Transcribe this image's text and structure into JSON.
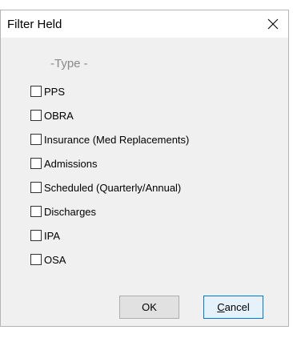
{
  "window": {
    "title": "Filter Held",
    "close_icon": "close-icon"
  },
  "type_group": {
    "label": "-Type -",
    "options": [
      {
        "label": "PPS",
        "checked": false
      },
      {
        "label": "OBRA",
        "checked": false
      },
      {
        "label": "Insurance (Med Replacements)",
        "checked": false
      },
      {
        "label": "Admissions",
        "checked": false
      },
      {
        "label": "Scheduled (Quarterly/Annual)",
        "checked": false
      },
      {
        "label": "Discharges",
        "checked": false
      },
      {
        "label": "IPA",
        "checked": false
      },
      {
        "label": "OSA",
        "checked": false
      }
    ]
  },
  "buttons": {
    "ok_label": "OK",
    "cancel_accel": "C",
    "cancel_rest": "ancel"
  },
  "colors": {
    "dialog_bg": "#f0f0f0",
    "titlebar_bg": "#ffffff",
    "group_label": "#8a8a8a",
    "default_button_border": "#0078d7"
  }
}
